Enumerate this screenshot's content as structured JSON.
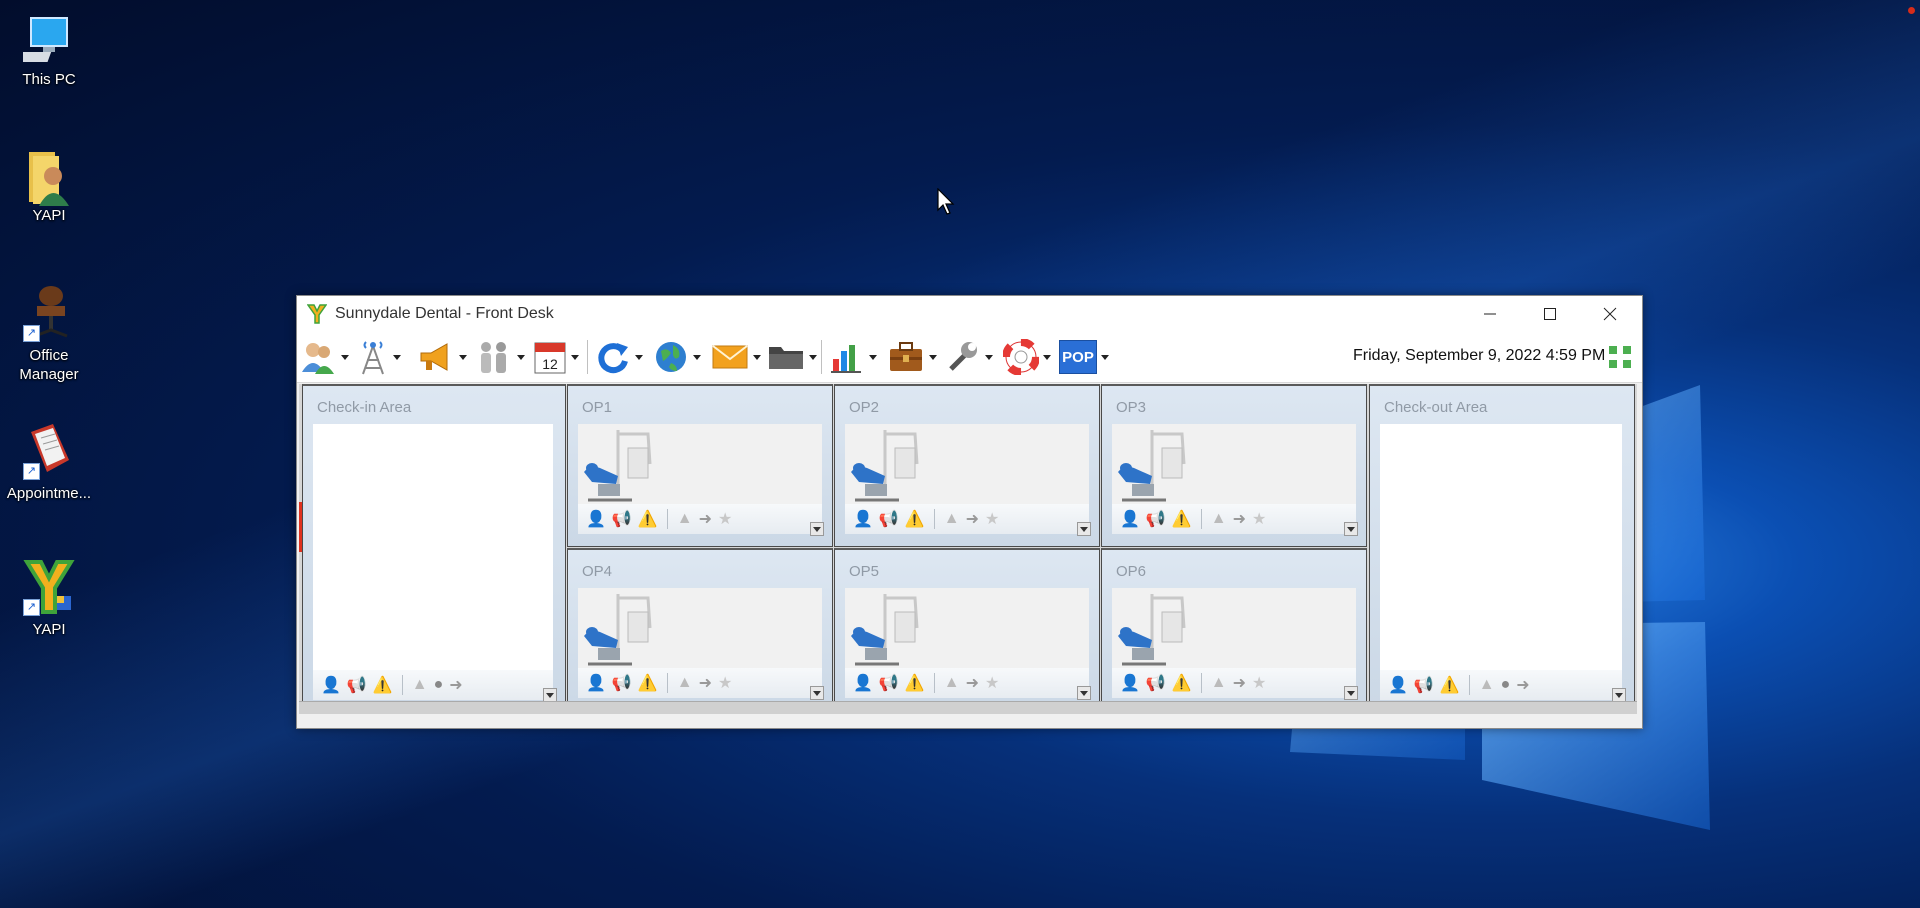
{
  "desktop": {
    "icons": [
      {
        "label": "This PC",
        "icon": "computer-icon"
      },
      {
        "label": "YAPI",
        "icon": "folder-user-icon"
      },
      {
        "label": "Office Manager",
        "icon": "chair-icon"
      },
      {
        "label": "Appointme...",
        "icon": "book-icon"
      },
      {
        "label": "YAPI",
        "icon": "yapi-logo-icon"
      }
    ]
  },
  "window": {
    "title": "Sunnydale Dental - Front Desk",
    "datetime": "Friday, September 9, 2022 4:59 PM",
    "pop_label": "POP",
    "calendar_day": "12"
  },
  "areas": {
    "checkin": {
      "label": "Check-in Area"
    },
    "checkout": {
      "label": "Check-out Area"
    },
    "ops": [
      {
        "label": "OP1"
      },
      {
        "label": "OP2"
      },
      {
        "label": "OP3"
      },
      {
        "label": "OP4"
      },
      {
        "label": "OP5"
      },
      {
        "label": "OP6"
      }
    ]
  },
  "colors": {
    "accent_red": "#e0321f",
    "pop_blue": "#2a6fd6",
    "panel_blue": "#cbd8e6"
  }
}
